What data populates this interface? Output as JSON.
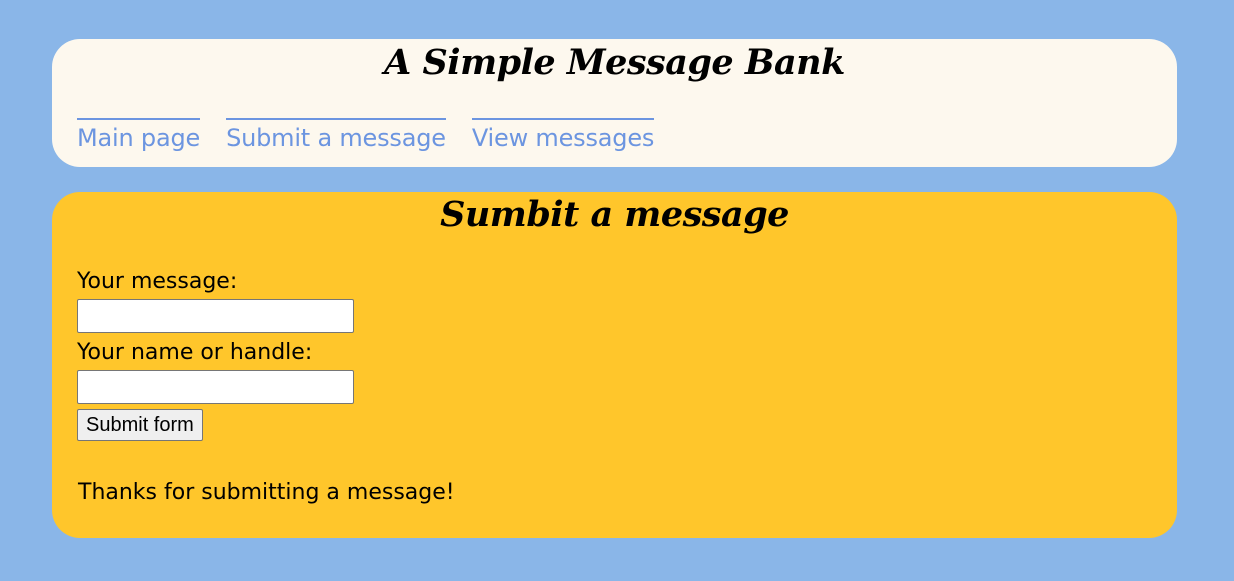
{
  "header": {
    "title": "A Simple Message Bank",
    "nav": [
      {
        "label": "Main page"
      },
      {
        "label": "Submit a message"
      },
      {
        "label": "View messages"
      }
    ]
  },
  "form": {
    "title": "Sumbit a message",
    "message_label": "Your message:",
    "message_value": "",
    "name_label": "Your name or handle:",
    "name_value": "",
    "submit_label": "Submit form",
    "thanks_text": "Thanks for submitting a message!"
  },
  "colors": {
    "background": "#8ab6e8",
    "header_panel": "#fdf8ee",
    "form_panel": "#ffc62b",
    "link": "#6c95e0"
  }
}
